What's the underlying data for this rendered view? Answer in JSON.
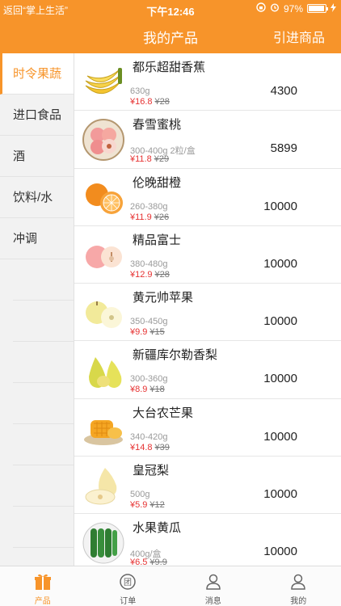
{
  "status": {
    "back_label": "返回“掌上生活”",
    "time": "下午12:46",
    "battery": "97%",
    "battery_level": 0.97
  },
  "header": {
    "title": "我的产品",
    "action_label": "引进商品"
  },
  "categories": [
    {
      "label": "时令果蔬",
      "active": true
    },
    {
      "label": "进口食品"
    },
    {
      "label": "酒"
    },
    {
      "label": "饮料/水"
    },
    {
      "label": "冲调"
    }
  ],
  "products": [
    {
      "name": "都乐超甜香蕉",
      "spec": "630g",
      "price": "¥16.8",
      "old_price": "¥28",
      "stock": "4300",
      "icon": "banana-icon"
    },
    {
      "name": "春雪蜜桃",
      "spec": "300-400g 2粒/盒",
      "price": "¥11.8",
      "old_price": "¥29",
      "stock": "5899",
      "icon": "peach-icon"
    },
    {
      "name": "伦晚甜橙",
      "spec": "260-380g",
      "price": "¥11.9",
      "old_price": "¥26",
      "stock": "10000",
      "icon": "orange-icon"
    },
    {
      "name": "精品富士",
      "spec": "380-480g",
      "price": "¥12.9",
      "old_price": "¥28",
      "stock": "10000",
      "icon": "apple-icon"
    },
    {
      "name": "黄元帅苹果",
      "spec": "350-450g",
      "price": "¥9.9",
      "old_price": "¥15",
      "stock": "10000",
      "icon": "yellow-apple-icon"
    },
    {
      "name": "新疆库尔勒香梨",
      "spec": "300-360g",
      "price": "¥8.9",
      "old_price": "¥18",
      "stock": "10000",
      "icon": "pear-icon"
    },
    {
      "name": "大台农芒果",
      "spec": "340-420g",
      "price": "¥14.8",
      "old_price": "¥39",
      "stock": "10000",
      "icon": "mango-icon"
    },
    {
      "name": "皇冠梨",
      "spec": "500g",
      "price": "¥5.9",
      "old_price": "¥12",
      "stock": "10000",
      "icon": "crown-pear-icon"
    },
    {
      "name": "水果黄瓜",
      "spec": "400g/盒",
      "price": "¥6.5",
      "old_price": "¥9.9",
      "stock": "10000",
      "icon": "cucumber-icon"
    }
  ],
  "tabs": [
    {
      "label": "产品",
      "icon": "gift-icon",
      "active": true
    },
    {
      "label": "订单",
      "icon": "order-icon"
    },
    {
      "label": "消息",
      "icon": "user-icon"
    },
    {
      "label": "我的",
      "icon": "profile-icon"
    }
  ],
  "colors": {
    "accent": "#f7942a",
    "price": "#e63232"
  }
}
